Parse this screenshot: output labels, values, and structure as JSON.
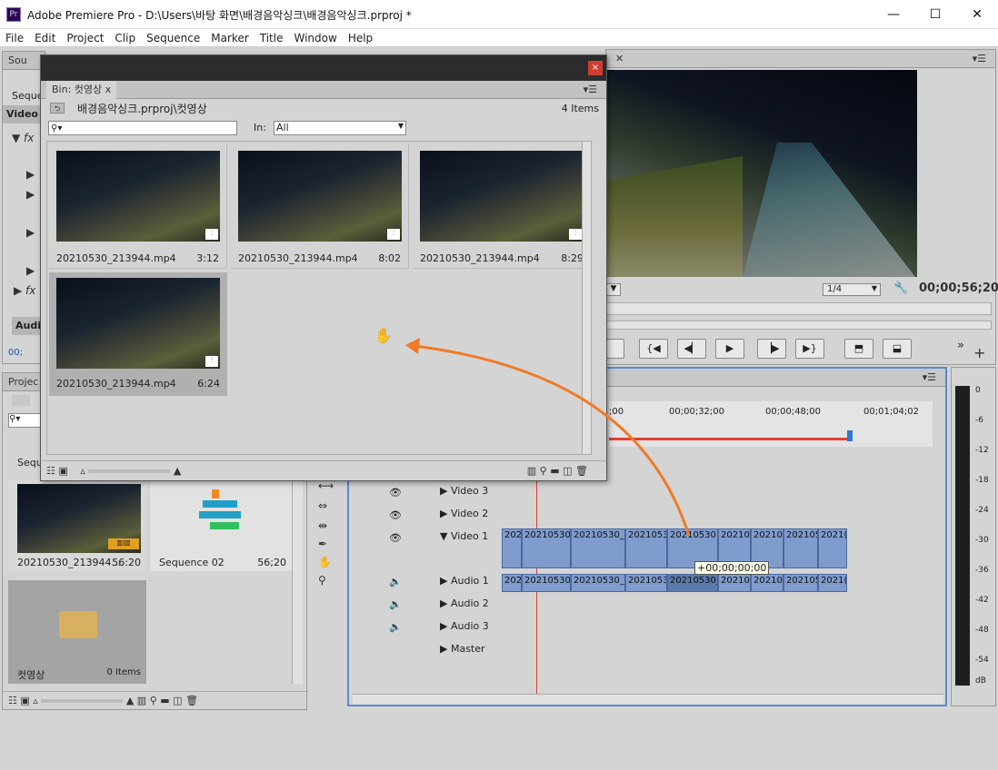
{
  "window": {
    "title": "Adobe Premiere Pro - D:\\Users\\바탕 화면\\배경음악싱크\\배경음악싱크.prproj *",
    "app_icon": "Pr",
    "minimize": "—",
    "maximize": "☐",
    "close": "✕"
  },
  "menu": [
    "File",
    "Edit",
    "Project",
    "Clip",
    "Sequence",
    "Marker",
    "Title",
    "Window",
    "Help"
  ],
  "source_panel": {
    "tab": "Sou",
    "label_seq": "Seque",
    "label_video": "Video",
    "label_audio": "Audio",
    "timecode": "00;"
  },
  "bin": {
    "tab": "Bin: 컷영상",
    "path": "배경음악싱크.prproj\\컷영상",
    "items_count": "4 Items",
    "in_label": "In:",
    "in_value": "All",
    "close": "x",
    "items": [
      {
        "name": "20210530_213944.mp4",
        "duration": "3:12"
      },
      {
        "name": "20210530_213944.mp4",
        "duration": "8:02"
      },
      {
        "name": "20210530_213944.mp4",
        "duration": "8:29"
      },
      {
        "name": "20210530_213944.mp4",
        "duration": "6:24"
      }
    ]
  },
  "program": {
    "zoom": "1/4",
    "timecode": "00;00;56;20"
  },
  "project": {
    "tab": "Projec",
    "seq_label": "Seque",
    "items": [
      {
        "name": "20210530_213944....",
        "duration": "56:20"
      },
      {
        "name": "Sequence 02",
        "duration": "56;20"
      },
      {
        "name": "컷영상",
        "duration": "0 Items"
      }
    ]
  },
  "timeline": {
    "ruler": [
      ";00",
      "00;00;32;00",
      "00;00;48;00",
      "00;01;04;02"
    ],
    "tracks": {
      "v3": "Video 3",
      "v2": "Video 2",
      "v1": "Video 1",
      "a1": "Audio 1",
      "a2": "Audio 2",
      "a3": "Audio 3",
      "master": "Master"
    },
    "clips_v": [
      "202",
      "20210530",
      "20210530_",
      "2021053",
      "20210530",
      "20210",
      "20210",
      "2021053",
      "2021("
    ],
    "clips_a": [
      "202",
      "20210530",
      "20210530_",
      "2021053",
      "20210530_",
      "20210",
      "20210",
      "2021053",
      "2021("
    ],
    "tooltip": "+00;00;00;00"
  },
  "meter": {
    "labels": [
      "0",
      "-6",
      "-12",
      "-18",
      "-24",
      "-30",
      "-36",
      "-42",
      "-48",
      "-54",
      "dB"
    ]
  },
  "colors": {
    "accent_orange": "#f07a26",
    "playhead": "#e04030",
    "clip_blue": "#7f9ccc"
  }
}
